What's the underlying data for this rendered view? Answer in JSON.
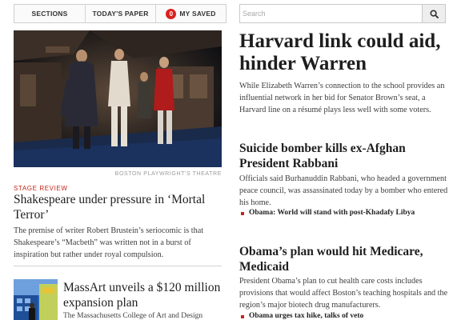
{
  "nav": {
    "tabs": [
      "SECTIONS",
      "TODAY'S PAPER",
      "MY SAVED"
    ],
    "saved_count": "0"
  },
  "search": {
    "placeholder": "Search",
    "icon": "magnifier-icon"
  },
  "left": {
    "hero_credit": "BOSTON PLAYWRIGHT'S THEATRE",
    "story1": {
      "kicker": "STAGE REVIEW",
      "headline": "Shakespeare under pressure in ‘Mortal Terror’",
      "dek": "The premise of writer Robert Brustein’s seriocomic is that Shakespeare’s “Macbeth” was written not in a burst of inspiration but rather under royal compulsion."
    },
    "story2": {
      "headline": "MassArt unveils a $120 million expansion plan",
      "dek": "The Massachusetts College of Art and Design"
    }
  },
  "right": {
    "lead": {
      "headline": "Harvard link could aid, hinder Warren",
      "dek": "While Elizabeth Warren’s connection to the school provides an influential network in her bid for Senator Brown’s seat, a Harvard line on a résumé plays less well with some voters."
    },
    "story2": {
      "headline": "Suicide bomber kills ex-Afghan President Rabbani",
      "dek": "Officials said Burhanuddin Rabbani, who headed a government peace council, was assassinated today by a bomber who entered his home.",
      "related": [
        "Obama: World will stand with post-Khadafy Libya"
      ]
    },
    "story3": {
      "headline": "Obama’s plan would hit Medicare, Medicaid",
      "dek": "President Obama’s plan to cut health care costs includes provisions that would affect Boston’s teaching hospitals and the region’s major biotech drug manufacturers.",
      "related": [
        "Obama urges tax hike, talks of veto"
      ]
    }
  },
  "colors": {
    "accent": "#c3261d",
    "badge": "#d8231f"
  }
}
